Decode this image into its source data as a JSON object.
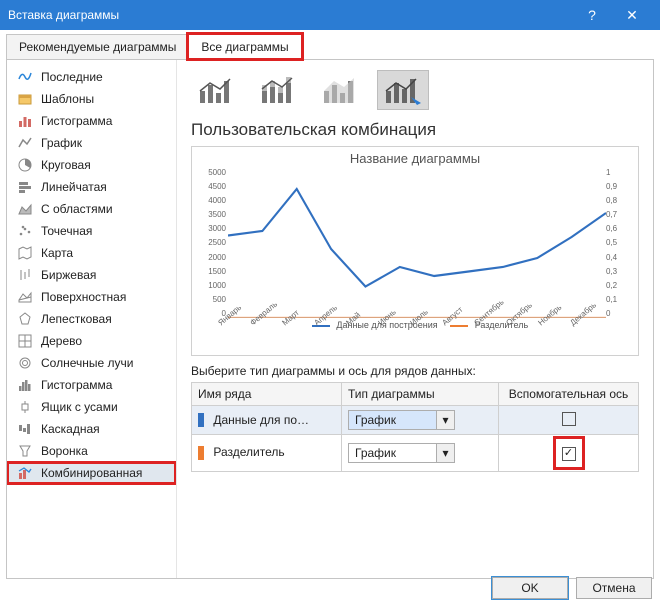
{
  "titlebar": {
    "title": "Вставка диаграммы"
  },
  "tabs": {
    "recommended": "Рекомендуемые диаграммы",
    "all": "Все диаграммы"
  },
  "sidebar": {
    "items": [
      {
        "label": "Последние"
      },
      {
        "label": "Шаблоны"
      },
      {
        "label": "Гистограмма"
      },
      {
        "label": "График"
      },
      {
        "label": "Круговая"
      },
      {
        "label": "Линейчатая"
      },
      {
        "label": "С областями"
      },
      {
        "label": "Точечная"
      },
      {
        "label": "Карта"
      },
      {
        "label": "Биржевая"
      },
      {
        "label": "Поверхностная"
      },
      {
        "label": "Лепестковая"
      },
      {
        "label": "Дерево"
      },
      {
        "label": "Солнечные лучи"
      },
      {
        "label": "Гистограмма"
      },
      {
        "label": "Ящик с усами"
      },
      {
        "label": "Каскадная"
      },
      {
        "label": "Воронка"
      },
      {
        "label": "Комбинированная"
      }
    ]
  },
  "section_title": "Пользовательская комбинация",
  "chart_data": {
    "type": "line",
    "title": "Название диаграммы",
    "x": [
      "Январь",
      "Февраль",
      "Март",
      "Апрель",
      "Май",
      "Июнь",
      "Июль",
      "Август",
      "Сентябрь",
      "Октябрь",
      "Ноябрь",
      "Декабрь"
    ],
    "series": [
      {
        "name": "Данные для построения",
        "color": "#3170c0",
        "axis": "left",
        "values": [
          2750,
          2900,
          4300,
          2300,
          1050,
          1700,
          1400,
          1550,
          1700,
          2000,
          2700,
          3500
        ]
      },
      {
        "name": "Разделитель",
        "color": "#ed7d31",
        "axis": "right",
        "values": [
          0,
          0,
          0,
          0,
          0,
          0,
          0,
          0,
          0,
          0,
          0,
          0
        ]
      }
    ],
    "ylim_left": [
      0,
      5000
    ],
    "yticks_left": [
      0,
      500,
      1000,
      1500,
      2000,
      2500,
      3000,
      3500,
      4000,
      4500,
      5000
    ],
    "ylim_right": [
      0,
      1
    ],
    "yticks_right": [
      0,
      0.1,
      0.2,
      0.3,
      0.4,
      0.5,
      0.6,
      0.7,
      0.8,
      0.9,
      1
    ]
  },
  "grid_label": "Выберите тип диаграммы и ось для рядов данных:",
  "grid_headers": {
    "name": "Имя ряда",
    "type": "Тип диаграммы",
    "axis": "Вспомогательная ось"
  },
  "rows": [
    {
      "name": "Данные для по…",
      "color": "#3170c0",
      "type": "График",
      "secondary": false,
      "selected": true
    },
    {
      "name": "Разделитель",
      "color": "#ed7d31",
      "type": "График",
      "secondary": true,
      "selected": false
    }
  ],
  "buttons": {
    "ok": "OK",
    "cancel": "Отмена"
  }
}
